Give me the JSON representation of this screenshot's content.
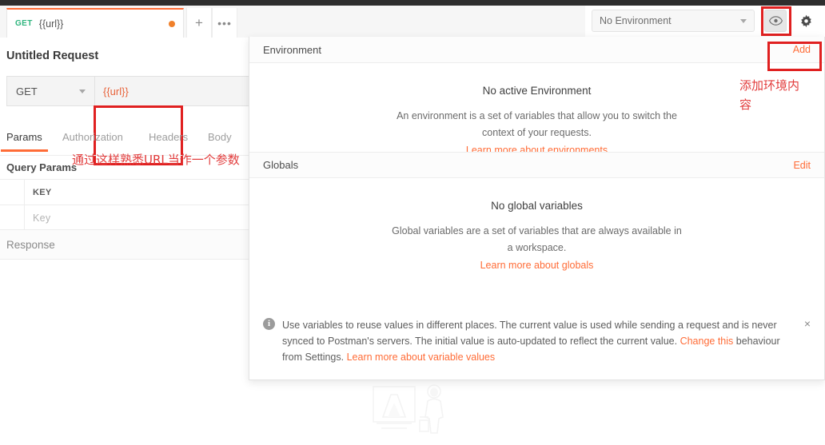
{
  "window": {
    "tab": {
      "method": "GET",
      "name": "{{url}}",
      "unsaved_dot": "●"
    },
    "tab_add_label": "+",
    "tab_more_label": "•••"
  },
  "environment_bar": {
    "selected": "No Environment",
    "eye_icon": "eye-icon",
    "gear_icon": "gear-icon"
  },
  "request": {
    "title": "Untitled Request",
    "method": "GET",
    "url_value": "{{url}}",
    "tabs": [
      {
        "label": "Params",
        "active": true
      },
      {
        "label": "Authorization",
        "active": false
      },
      {
        "label": "Headers",
        "active": false
      },
      {
        "label": "Body",
        "active": false
      }
    ],
    "query_params_title": "Query Params",
    "table": {
      "header": "KEY",
      "placeholder_row": "Key"
    },
    "response_label": "Response"
  },
  "env_panel": {
    "header": {
      "title": "Environment",
      "action": "Add"
    },
    "empty": {
      "title": "No active Environment",
      "description": "An environment is a set of variables that allow you to switch the context of your requests.",
      "link": "Learn more about environments"
    },
    "globals": {
      "title": "Globals",
      "action": "Edit",
      "empty_title": "No global variables",
      "empty_description": "Global variables are a set of variables that are always available in a workspace.",
      "link": "Learn more about globals"
    },
    "info": {
      "part1": "Use variables to reuse values in different places. The current value is used while sending a request and is never synced to Postman's servers. The initial value is auto-updated to reflect the current value. ",
      "link1": "Change this",
      "part2": " behaviour from Settings. ",
      "link2": "Learn more about variable values",
      "close_icon": "×"
    }
  },
  "annotations": [
    {
      "text": "通过这样熟悉URL当作一个参数"
    },
    {
      "text": "添加环境内\n容"
    }
  ],
  "colors": {
    "accent": "#ff6c37",
    "method_get": "#2db47d",
    "annotation_red": "#e23c3c",
    "highlight_box": "#e02020",
    "topbar": "#2e2e2e"
  }
}
